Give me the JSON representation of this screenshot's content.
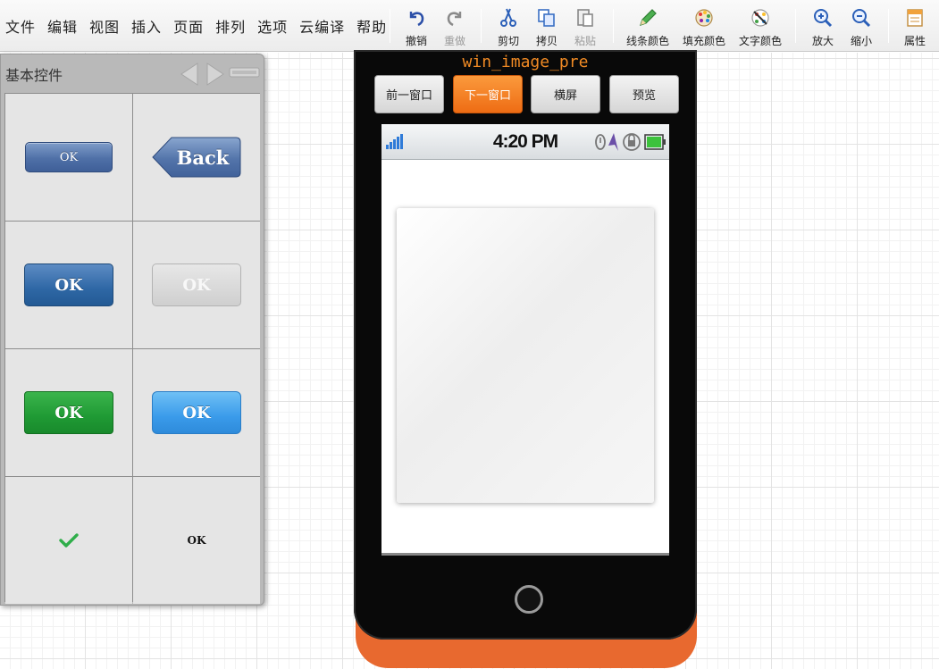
{
  "menus": [
    "文件",
    "编辑",
    "视图",
    "插入",
    "页面",
    "排列",
    "选项",
    "云编译",
    "帮助"
  ],
  "tools": {
    "undo": "撤销",
    "redo": "重做",
    "cut": "剪切",
    "copy": "拷贝",
    "paste": "粘贴",
    "line_color": "线条颜色",
    "fill_color": "填充颜色",
    "text_color": "文字颜色",
    "zoom_in": "放大",
    "zoom_out": "缩小",
    "properties": "属性"
  },
  "panel": {
    "title": "基本控件",
    "controls": {
      "ok_small": "OK",
      "back": "Back",
      "ok_blue": "OK",
      "ok_disabled": "OK",
      "ok_green": "OK",
      "ok_lightblue": "OK",
      "check_icon": "check-icon",
      "ok_plain": "OK"
    }
  },
  "phone": {
    "window_title": "win_image_pre",
    "buttons": {
      "prev": "前一窗口",
      "next": "下一窗口",
      "landscape": "横屏",
      "preview": "预览"
    },
    "status_bar": {
      "time": "4:20 PM"
    }
  },
  "colors": {
    "phone_accent": "#e8692f",
    "active_button": "#ee6c14",
    "title_orange": "#f08a24"
  }
}
